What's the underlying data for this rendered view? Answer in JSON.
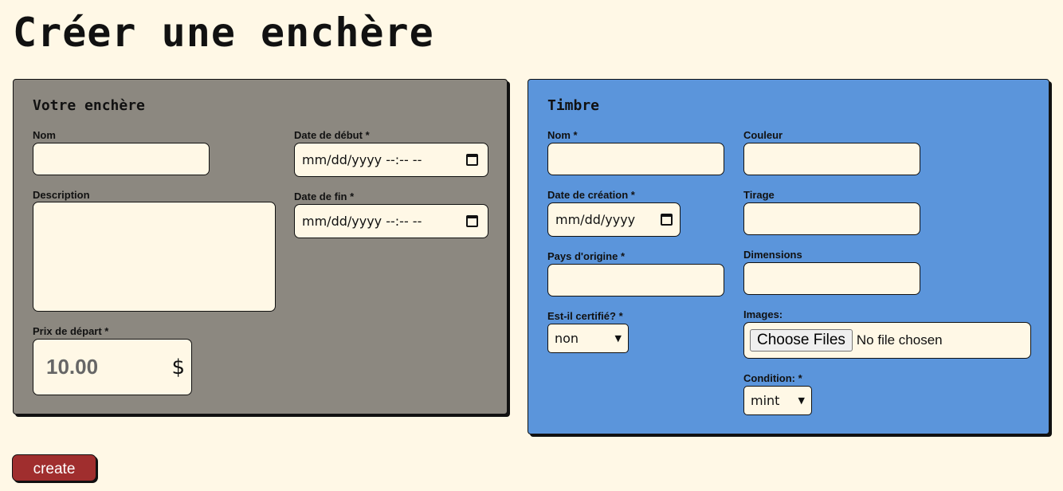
{
  "page": {
    "title": "Créer une enchère"
  },
  "auction": {
    "title": "Votre enchère",
    "name_label": "Nom",
    "description_label": "Description",
    "start_date_label": "Date de début *",
    "start_date_placeholder": "mm/dd/yyyy --:-- --",
    "end_date_label": "Date de fin *",
    "end_date_placeholder": "mm/dd/yyyy --:-- --",
    "price_label": "Prix de départ *",
    "price_value": "10.00",
    "currency_symbol": "$"
  },
  "stamp": {
    "title": "Timbre",
    "name_label": "Nom *",
    "color_label": "Couleur",
    "creation_date_label": "Date de création *",
    "creation_date_placeholder": "mm/dd/yyyy",
    "print_run_label": "Tirage",
    "origin_label": "Pays d'origine *",
    "dimensions_label": "Dimensions",
    "certified_label": "Est-il certifié? *",
    "certified_value": "non",
    "images_label": "Images:",
    "choose_files_label": "Choose Files",
    "no_file_text": "No file chosen",
    "condition_label": "Condition: *",
    "condition_value": "mint"
  },
  "actions": {
    "create_label": "create"
  },
  "colors": {
    "background": "#fff8e6",
    "auction_panel": "#8c8880",
    "stamp_panel": "#5b95db",
    "create_button": "#a02e2e"
  }
}
